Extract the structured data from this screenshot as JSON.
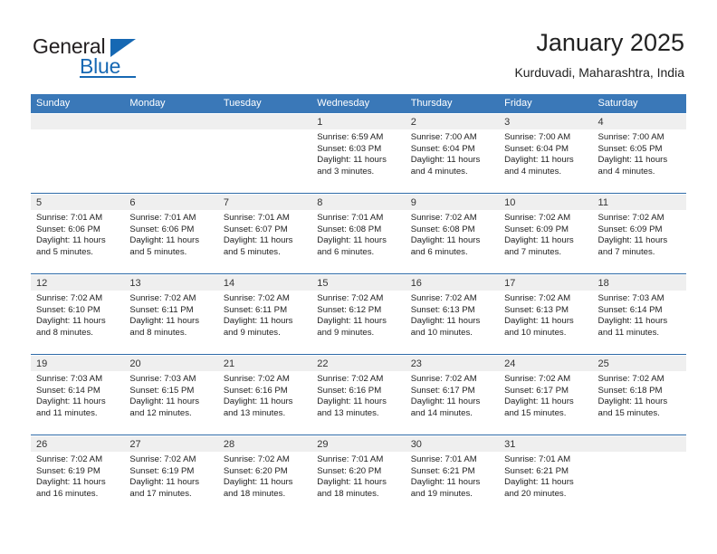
{
  "brand": {
    "name_part1": "General",
    "name_part2": "Blue",
    "accent_color": "#1668b3"
  },
  "header": {
    "title": "January 2025",
    "subtitle": "Kurduvadi, Maharashtra, India"
  },
  "calendar": {
    "header_color": "#3a78b8",
    "weekdays": [
      "Sunday",
      "Monday",
      "Tuesday",
      "Wednesday",
      "Thursday",
      "Friday",
      "Saturday"
    ],
    "weeks": [
      [
        {
          "day": "",
          "lines": []
        },
        {
          "day": "",
          "lines": []
        },
        {
          "day": "",
          "lines": []
        },
        {
          "day": "1",
          "lines": [
            "Sunrise: 6:59 AM",
            "Sunset: 6:03 PM",
            "Daylight: 11 hours",
            "and 3 minutes."
          ]
        },
        {
          "day": "2",
          "lines": [
            "Sunrise: 7:00 AM",
            "Sunset: 6:04 PM",
            "Daylight: 11 hours",
            "and 4 minutes."
          ]
        },
        {
          "day": "3",
          "lines": [
            "Sunrise: 7:00 AM",
            "Sunset: 6:04 PM",
            "Daylight: 11 hours",
            "and 4 minutes."
          ]
        },
        {
          "day": "4",
          "lines": [
            "Sunrise: 7:00 AM",
            "Sunset: 6:05 PM",
            "Daylight: 11 hours",
            "and 4 minutes."
          ]
        }
      ],
      [
        {
          "day": "5",
          "lines": [
            "Sunrise: 7:01 AM",
            "Sunset: 6:06 PM",
            "Daylight: 11 hours",
            "and 5 minutes."
          ]
        },
        {
          "day": "6",
          "lines": [
            "Sunrise: 7:01 AM",
            "Sunset: 6:06 PM",
            "Daylight: 11 hours",
            "and 5 minutes."
          ]
        },
        {
          "day": "7",
          "lines": [
            "Sunrise: 7:01 AM",
            "Sunset: 6:07 PM",
            "Daylight: 11 hours",
            "and 5 minutes."
          ]
        },
        {
          "day": "8",
          "lines": [
            "Sunrise: 7:01 AM",
            "Sunset: 6:08 PM",
            "Daylight: 11 hours",
            "and 6 minutes."
          ]
        },
        {
          "day": "9",
          "lines": [
            "Sunrise: 7:02 AM",
            "Sunset: 6:08 PM",
            "Daylight: 11 hours",
            "and 6 minutes."
          ]
        },
        {
          "day": "10",
          "lines": [
            "Sunrise: 7:02 AM",
            "Sunset: 6:09 PM",
            "Daylight: 11 hours",
            "and 7 minutes."
          ]
        },
        {
          "day": "11",
          "lines": [
            "Sunrise: 7:02 AM",
            "Sunset: 6:09 PM",
            "Daylight: 11 hours",
            "and 7 minutes."
          ]
        }
      ],
      [
        {
          "day": "12",
          "lines": [
            "Sunrise: 7:02 AM",
            "Sunset: 6:10 PM",
            "Daylight: 11 hours",
            "and 8 minutes."
          ]
        },
        {
          "day": "13",
          "lines": [
            "Sunrise: 7:02 AM",
            "Sunset: 6:11 PM",
            "Daylight: 11 hours",
            "and 8 minutes."
          ]
        },
        {
          "day": "14",
          "lines": [
            "Sunrise: 7:02 AM",
            "Sunset: 6:11 PM",
            "Daylight: 11 hours",
            "and 9 minutes."
          ]
        },
        {
          "day": "15",
          "lines": [
            "Sunrise: 7:02 AM",
            "Sunset: 6:12 PM",
            "Daylight: 11 hours",
            "and 9 minutes."
          ]
        },
        {
          "day": "16",
          "lines": [
            "Sunrise: 7:02 AM",
            "Sunset: 6:13 PM",
            "Daylight: 11 hours",
            "and 10 minutes."
          ]
        },
        {
          "day": "17",
          "lines": [
            "Sunrise: 7:02 AM",
            "Sunset: 6:13 PM",
            "Daylight: 11 hours",
            "and 10 minutes."
          ]
        },
        {
          "day": "18",
          "lines": [
            "Sunrise: 7:03 AM",
            "Sunset: 6:14 PM",
            "Daylight: 11 hours",
            "and 11 minutes."
          ]
        }
      ],
      [
        {
          "day": "19",
          "lines": [
            "Sunrise: 7:03 AM",
            "Sunset: 6:14 PM",
            "Daylight: 11 hours",
            "and 11 minutes."
          ]
        },
        {
          "day": "20",
          "lines": [
            "Sunrise: 7:03 AM",
            "Sunset: 6:15 PM",
            "Daylight: 11 hours",
            "and 12 minutes."
          ]
        },
        {
          "day": "21",
          "lines": [
            "Sunrise: 7:02 AM",
            "Sunset: 6:16 PM",
            "Daylight: 11 hours",
            "and 13 minutes."
          ]
        },
        {
          "day": "22",
          "lines": [
            "Sunrise: 7:02 AM",
            "Sunset: 6:16 PM",
            "Daylight: 11 hours",
            "and 13 minutes."
          ]
        },
        {
          "day": "23",
          "lines": [
            "Sunrise: 7:02 AM",
            "Sunset: 6:17 PM",
            "Daylight: 11 hours",
            "and 14 minutes."
          ]
        },
        {
          "day": "24",
          "lines": [
            "Sunrise: 7:02 AM",
            "Sunset: 6:17 PM",
            "Daylight: 11 hours",
            "and 15 minutes."
          ]
        },
        {
          "day": "25",
          "lines": [
            "Sunrise: 7:02 AM",
            "Sunset: 6:18 PM",
            "Daylight: 11 hours",
            "and 15 minutes."
          ]
        }
      ],
      [
        {
          "day": "26",
          "lines": [
            "Sunrise: 7:02 AM",
            "Sunset: 6:19 PM",
            "Daylight: 11 hours",
            "and 16 minutes."
          ]
        },
        {
          "day": "27",
          "lines": [
            "Sunrise: 7:02 AM",
            "Sunset: 6:19 PM",
            "Daylight: 11 hours",
            "and 17 minutes."
          ]
        },
        {
          "day": "28",
          "lines": [
            "Sunrise: 7:02 AM",
            "Sunset: 6:20 PM",
            "Daylight: 11 hours",
            "and 18 minutes."
          ]
        },
        {
          "day": "29",
          "lines": [
            "Sunrise: 7:01 AM",
            "Sunset: 6:20 PM",
            "Daylight: 11 hours",
            "and 18 minutes."
          ]
        },
        {
          "day": "30",
          "lines": [
            "Sunrise: 7:01 AM",
            "Sunset: 6:21 PM",
            "Daylight: 11 hours",
            "and 19 minutes."
          ]
        },
        {
          "day": "31",
          "lines": [
            "Sunrise: 7:01 AM",
            "Sunset: 6:21 PM",
            "Daylight: 11 hours",
            "and 20 minutes."
          ]
        },
        {
          "day": "",
          "lines": []
        }
      ]
    ]
  }
}
